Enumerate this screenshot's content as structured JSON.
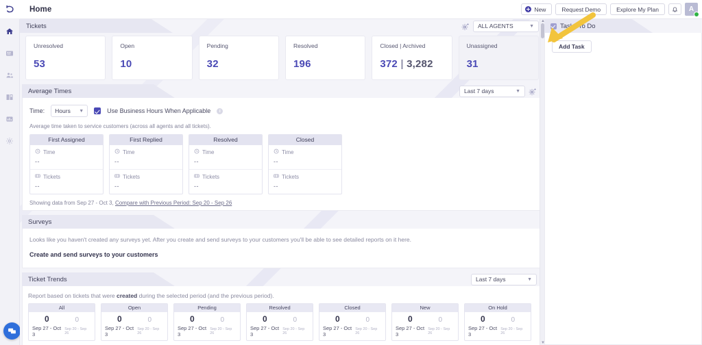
{
  "app": {
    "page_title": "Home",
    "logo_icon": "undo-logo-icon"
  },
  "sidebar": {
    "items": [
      {
        "name": "home",
        "icon": "home-icon",
        "active": true
      },
      {
        "name": "tickets",
        "icon": "tickets-grid-icon",
        "active": false
      },
      {
        "name": "contacts",
        "icon": "contacts-people-icon",
        "active": false
      },
      {
        "name": "knowledge-base",
        "icon": "book-icon",
        "active": false
      },
      {
        "name": "reports",
        "icon": "reports-chart-icon",
        "active": false
      },
      {
        "name": "settings",
        "icon": "gear-icon",
        "active": false
      }
    ],
    "chat_icon": "chat-bubble-icon"
  },
  "topbar": {
    "new_label": "New",
    "new_icon": "plus-circle-icon",
    "request_demo_label": "Request Demo",
    "explore_plan_label": "Explore My Plan",
    "bell_icon": "bell-icon",
    "avatar_initial": "A",
    "avatar_status": "online"
  },
  "tickets": {
    "section_title": "Tickets",
    "gear_icon": "gear-plus-icon",
    "agent_filter": "ALL AGENTS",
    "caret_icon": "chevron-down-icon",
    "cards": [
      {
        "label": "Unresolved",
        "value": "53",
        "muted": false
      },
      {
        "label": "Open",
        "value": "10",
        "muted": false
      },
      {
        "label": "Pending",
        "value": "32",
        "muted": false
      },
      {
        "label": "Resolved",
        "value": "196",
        "muted": false
      },
      {
        "label": "Closed | Archived",
        "value": "372",
        "separator": " | ",
        "value2": "3,282",
        "muted": false
      },
      {
        "label": "Unassigned",
        "value": "31",
        "muted": true
      }
    ],
    "accent_color": "#4a49b5"
  },
  "average_times": {
    "section_title": "Average Times",
    "range_filter": "Last 7 days",
    "gear_icon": "gear-plus-icon",
    "time_label": "Time:",
    "time_unit": "Hours",
    "business_hours_label": "Use Business Hours When Applicable",
    "business_hours_checked": true,
    "info_icon": "info-icon",
    "description": "Average time taken to service customers (across all agents and all tickets).",
    "columns": [
      {
        "title": "First Assigned",
        "time_label": "Time",
        "time_value": "--",
        "tickets_label": "Tickets",
        "tickets_value": "--"
      },
      {
        "title": "First Replied",
        "time_label": "Time",
        "time_value": "--",
        "tickets_label": "Tickets",
        "tickets_value": "--"
      },
      {
        "title": "Resolved",
        "time_label": "Time",
        "time_value": "--",
        "tickets_label": "Tickets",
        "tickets_value": "--"
      },
      {
        "title": "Closed",
        "time_label": "Time",
        "time_value": "--",
        "tickets_label": "Tickets",
        "tickets_value": "--"
      }
    ],
    "footer_prefix": "Showing data from Sep 27 - Oct 3, ",
    "footer_link": "Compare with Previous Period: Sep 20 - Sep 26",
    "clock_icon": "clock-icon",
    "ticket_icon": "ticket-icon"
  },
  "surveys": {
    "section_title": "Surveys",
    "empty_text": "Looks like you haven't created any surveys yet. After you create and send surveys to your customers you'll be able to see detailed reports on it here.",
    "cta_label": "Create and send surveys to your customers"
  },
  "ticket_trends": {
    "section_title": "Ticket Trends",
    "range_filter": "Last 7 days",
    "caret_icon": "chevron-down-icon",
    "note_prefix": "Report based on tickets that were ",
    "note_bold": "created",
    "note_suffix": " during the selected period (and the previous period).",
    "current_range": "Sep 27 - Oct 3",
    "previous_range": "Sep 20 - Sep 26",
    "cards": [
      {
        "title": "All",
        "current": "0",
        "previous": "0"
      },
      {
        "title": "Open",
        "current": "0",
        "previous": "0"
      },
      {
        "title": "Pending",
        "current": "0",
        "previous": "0"
      },
      {
        "title": "Resolved",
        "current": "0",
        "previous": "0"
      },
      {
        "title": "Closed",
        "current": "0",
        "previous": "0"
      },
      {
        "title": "New",
        "current": "0",
        "previous": "0"
      },
      {
        "title": "On Hold",
        "current": "0",
        "previous": "0"
      }
    ]
  },
  "tasks": {
    "section_title": "Tasks To Do",
    "checked": true,
    "add_task_label": "Add Task"
  },
  "annotation": {
    "arrow_icon": "yellow-arrow-icon",
    "arrow_color": "#f5c542"
  }
}
